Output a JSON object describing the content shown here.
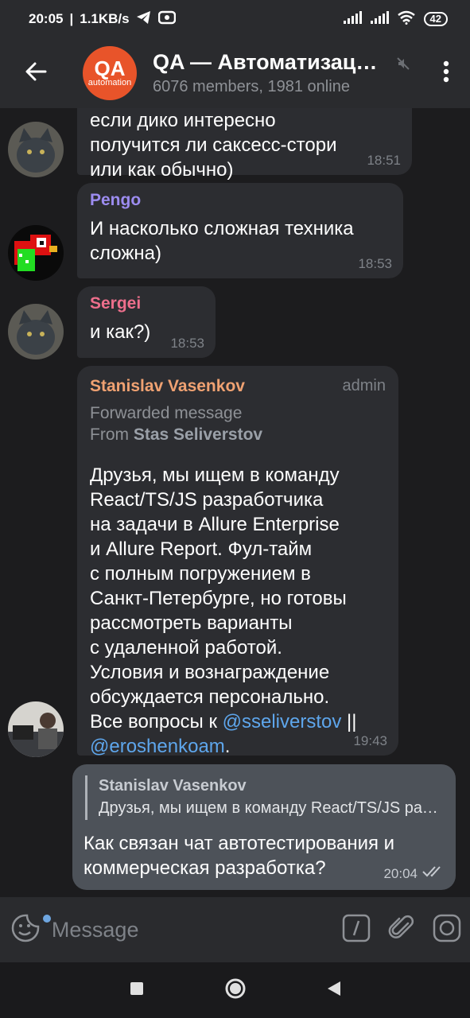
{
  "status_bar": {
    "time": "20:05",
    "speed": "1.1KB/s",
    "battery": "42"
  },
  "header": {
    "title": "QA — Автоматизац…",
    "subtitle": "6076 members, 1981 online",
    "avatar_line1": "QA",
    "avatar_line2": "automation"
  },
  "messages": [
    {
      "sender": "",
      "text_lines": [
        "если дико интересно",
        "получится ли саксесс-стори",
        "или как обычно)"
      ],
      "time": "18:51"
    },
    {
      "sender": "Pengo",
      "sender_color": "#9c8cf0",
      "text_lines": [
        "И насколько сложная техника",
        "сложна)"
      ],
      "time": "18:53"
    },
    {
      "sender": "Sergei",
      "sender_color": "#ee6f8c",
      "text_lines": [
        "и как?)"
      ],
      "time": "18:53"
    },
    {
      "sender": "Stanislav Vasenkov",
      "sender_color": "#f0a272",
      "badge": "admin",
      "forwarded_label": "Forwarded message",
      "forwarded_from_prefix": "From ",
      "forwarded_from": "Stas Seliverstov",
      "text_lines": [
        "Друзья, мы ищем в команду",
        "React/TS/JS разработчика",
        "на задачи в Allure Enterprise",
        "и Allure Report. Фул-тайм",
        "с полным погружением в",
        "Санкт-Петербурге, но готовы",
        "рассмотреть варианты",
        "с удаленной работой.",
        "Условия и вознаграждение",
        "обсуждается персонально.",
        "Все вопросы к"
      ],
      "mention1": "@sseliverstov",
      "separator": " ||",
      "mention2": "@eroshenkoam",
      "tail": ".",
      "time": "19:43"
    },
    {
      "own": true,
      "reply_name": "Stanislav Vasenkov",
      "reply_text": "Друзья, мы ищем в команду React/TS/JS разработчика",
      "text_lines": [
        "Как связан чат автотестирования и",
        "коммерческая разработка?"
      ],
      "time": "20:04"
    }
  ],
  "input": {
    "placeholder": "Message"
  },
  "colors": {
    "background": "#1c1c1e",
    "bubble": "#2c2d31",
    "own_bubble": "#4d5259",
    "header": "#2a2b2e",
    "link": "#5ea6ec"
  },
  "icons": {
    "back": "arrow-left-icon",
    "mute": "mute-icon",
    "menu": "more-vertical-icon",
    "emoji": "sticker-icon",
    "command": "command-slash-icon",
    "attach": "paperclip-icon",
    "camera": "camera-icon"
  }
}
